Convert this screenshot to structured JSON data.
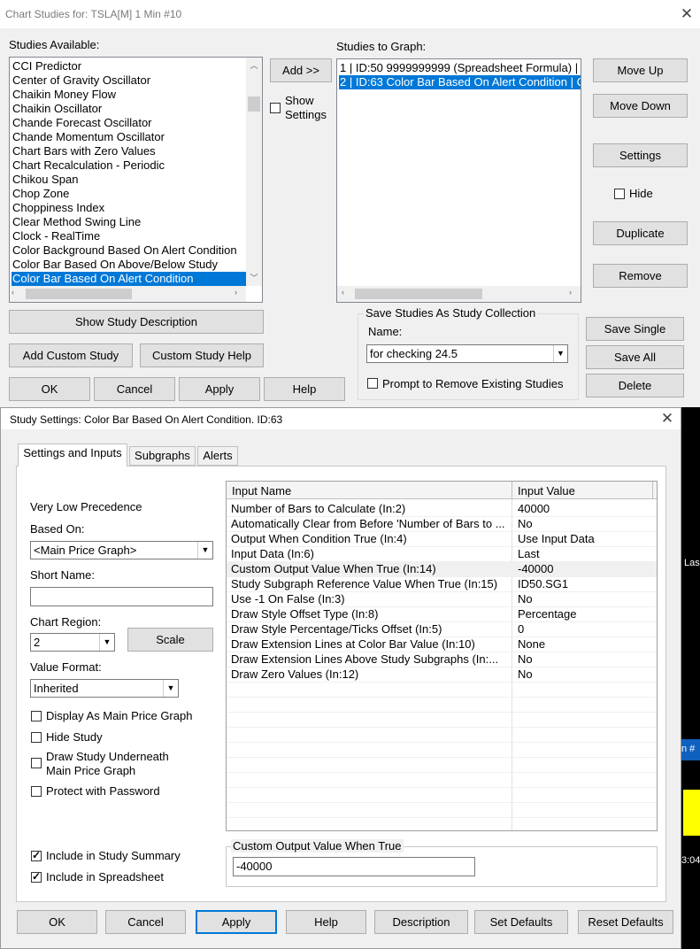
{
  "top_window": {
    "title": "Chart Studies for: TSLA[M]  1 Min   #10",
    "studies_available_label": "Studies Available:",
    "studies_available": [
      "CCI Predictor",
      "Center of Gravity Oscillator",
      "Chaikin Money Flow",
      "Chaikin Oscillator",
      "Chande Forecast Oscillator",
      "Chande Momentum Oscillator",
      "Chart Bars with Zero Values",
      "Chart Recalculation - Periodic",
      "Chikou Span",
      "Chop Zone",
      "Choppiness Index",
      "Clear Method Swing Line",
      "Clock - RealTime",
      "Color Background Based On Alert Condition",
      "Color Bar Based On Above/Below Study",
      "Color Bar Based On Alert Condition"
    ],
    "add_button": "Add >>",
    "show_settings_label": "Show\nSettings",
    "show_settings_line1": "Show",
    "show_settings_line2": "Settings",
    "studies_to_graph_label": "Studies to Graph:",
    "studies_to_graph": [
      "1 | ID:50  9999999999 (Spreadsheet Formula) |",
      "2 | ID:63  Color Bar Based On Alert Condition | C"
    ],
    "move_up": "Move Up",
    "move_down": "Move Down",
    "settings": "Settings",
    "hide": "Hide",
    "duplicate": "Duplicate",
    "remove": "Remove",
    "show_study_description": "Show Study Description",
    "add_custom_study": "Add Custom Study",
    "custom_study_help": "Custom Study Help",
    "ok": "OK",
    "cancel": "Cancel",
    "apply": "Apply",
    "help": "Help",
    "collection_group_title": "Save Studies As Study Collection",
    "name_label": "Name:",
    "collection_name": "for checking 24.5",
    "prompt_remove": "Prompt to Remove Existing Studies",
    "save_single": "Save Single",
    "save_all": "Save All",
    "delete": "Delete"
  },
  "settings_window": {
    "title": "Study Settings: Color Bar Based On Alert Condition. ID:63",
    "tabs": [
      "Settings and Inputs",
      "Subgraphs",
      "Alerts"
    ],
    "precedence": "Very Low Precedence",
    "based_on_label": "Based On:",
    "based_on_value": "<Main Price Graph>",
    "short_name_label": "Short Name:",
    "short_name_value": "",
    "chart_region_label": "Chart Region:",
    "chart_region_value": "2",
    "scale_button": "Scale",
    "value_format_label": "Value Format:",
    "value_format_value": "Inherited",
    "checkboxes": {
      "display_as_main": "Display As Main Price Graph",
      "hide_study": "Hide Study",
      "draw_underneath_1": "Draw Study Underneath",
      "draw_underneath_2": "Main Price Graph",
      "protect_password": "Protect with Password",
      "include_summary": "Include in Study Summary",
      "include_spreadsheet": "Include in Spreadsheet"
    },
    "grid_header_name": "Input Name",
    "grid_header_value": "Input Value",
    "inputs": [
      {
        "name": "Number of Bars to Calculate  (In:2)",
        "value": "40000"
      },
      {
        "name": "Automatically Clear from Before 'Number of Bars to ...",
        "value": "No"
      },
      {
        "name": "Output When Condition True  (In:4)",
        "value": "Use Input Data"
      },
      {
        "name": "Input Data  (In:6)",
        "value": "Last"
      },
      {
        "name": "Custom Output Value When True  (In:14)",
        "value": "-40000"
      },
      {
        "name": "Study Subgraph Reference Value When True  (In:15)",
        "value": "ID50.SG1"
      },
      {
        "name": "Use -1 On False  (In:3)",
        "value": "No"
      },
      {
        "name": "Draw Style Offset Type  (In:8)",
        "value": "Percentage"
      },
      {
        "name": "Draw Style Percentage/Ticks Offset  (In:5)",
        "value": "0"
      },
      {
        "name": "Draw Extension Lines at Color Bar Value  (In:10)",
        "value": "None"
      },
      {
        "name": "Draw Extension Lines Above Study Subgraphs  (In:...",
        "value": "No"
      },
      {
        "name": "Draw Zero Values  (In:12)",
        "value": "No"
      }
    ],
    "edit_group_title": "Custom Output Value When True",
    "edit_value": "-40000",
    "bottom_buttons": {
      "ok": "OK",
      "cancel": "Cancel",
      "apply": "Apply",
      "help": "Help",
      "description": "Description",
      "set_defaults": "Set Defaults",
      "reset_defaults": "Reset Defaults"
    }
  },
  "background": {
    "las_text": "Las",
    "n_text": "n #",
    "time_text": "3:04"
  },
  "colors": {
    "selection": "#0078d7",
    "yellow": "#ffff00",
    "chart_bg": "#000000"
  }
}
